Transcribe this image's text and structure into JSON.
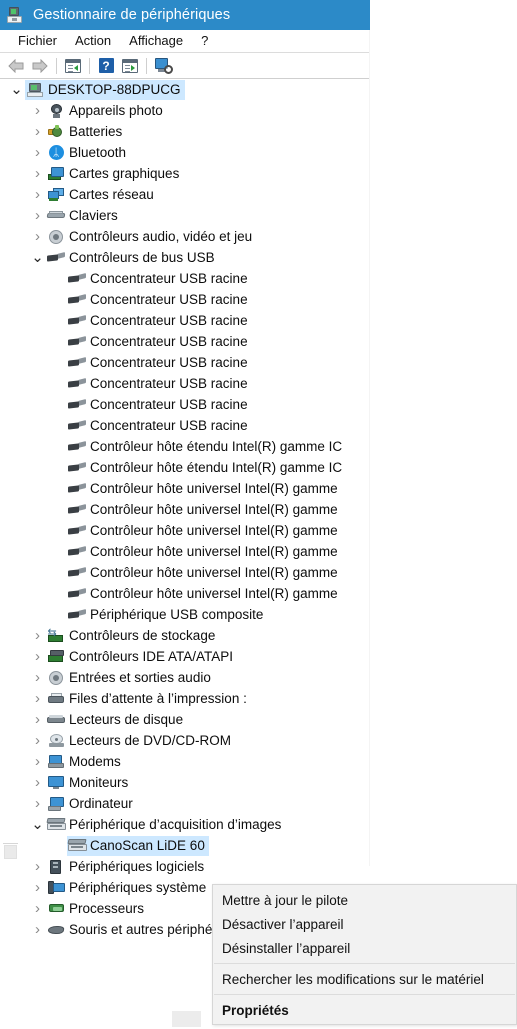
{
  "window": {
    "title": "Gestionnaire de périphériques",
    "icon": "device-manager-icon"
  },
  "menubar": {
    "items": [
      {
        "label": "Fichier",
        "name": "menu-fichier"
      },
      {
        "label": "Action",
        "name": "menu-action"
      },
      {
        "label": "Affichage",
        "name": "menu-affichage"
      },
      {
        "label": "?",
        "name": "menu-help"
      }
    ]
  },
  "toolbar": {
    "buttons": [
      {
        "icon": "back-arrow-icon",
        "label": ""
      },
      {
        "icon": "forward-arrow-icon",
        "label": ""
      },
      {
        "icon": "properties-icon",
        "label": ""
      },
      {
        "icon": "help-icon",
        "label": "?"
      },
      {
        "icon": "update-driver-icon",
        "label": ""
      },
      {
        "icon": "scan-hardware-changes-icon",
        "label": ""
      }
    ]
  },
  "tree": {
    "rows": [
      {
        "depth": 0,
        "chev": "open",
        "icon": "computer-icon",
        "label": "DESKTOP-88DPUCG",
        "selected": true
      },
      {
        "depth": 1,
        "chev": "closed",
        "icon": "camera-icon",
        "label": "Appareils photo"
      },
      {
        "depth": 1,
        "chev": "closed",
        "icon": "battery-icon",
        "label": "Batteries"
      },
      {
        "depth": 1,
        "chev": "closed",
        "icon": "bluetooth-icon",
        "label": "Bluetooth"
      },
      {
        "depth": 1,
        "chev": "closed",
        "icon": "display-adapter-icon",
        "label": "Cartes graphiques"
      },
      {
        "depth": 1,
        "chev": "closed",
        "icon": "network-adapter-icon",
        "label": "Cartes réseau"
      },
      {
        "depth": 1,
        "chev": "closed",
        "icon": "keyboard-icon",
        "label": "Claviers"
      },
      {
        "depth": 1,
        "chev": "closed",
        "icon": "audio-icon",
        "label": "Contrôleurs audio, vidéo et jeu"
      },
      {
        "depth": 1,
        "chev": "open",
        "icon": "usb-icon",
        "label": "Contrôleurs de bus USB"
      },
      {
        "depth": 2,
        "chev": "blank",
        "icon": "usb-icon",
        "label": "Concentrateur USB racine"
      },
      {
        "depth": 2,
        "chev": "blank",
        "icon": "usb-icon",
        "label": "Concentrateur USB racine"
      },
      {
        "depth": 2,
        "chev": "blank",
        "icon": "usb-icon",
        "label": "Concentrateur USB racine"
      },
      {
        "depth": 2,
        "chev": "blank",
        "icon": "usb-icon",
        "label": "Concentrateur USB racine"
      },
      {
        "depth": 2,
        "chev": "blank",
        "icon": "usb-icon",
        "label": "Concentrateur USB racine"
      },
      {
        "depth": 2,
        "chev": "blank",
        "icon": "usb-icon",
        "label": "Concentrateur USB racine"
      },
      {
        "depth": 2,
        "chev": "blank",
        "icon": "usb-icon",
        "label": "Concentrateur USB racine"
      },
      {
        "depth": 2,
        "chev": "blank",
        "icon": "usb-icon",
        "label": "Concentrateur USB racine"
      },
      {
        "depth": 2,
        "chev": "blank",
        "icon": "usb-icon",
        "label": "Contrôleur hôte étendu Intel(R) gamme IC"
      },
      {
        "depth": 2,
        "chev": "blank",
        "icon": "usb-icon",
        "label": "Contrôleur hôte étendu Intel(R) gamme IC"
      },
      {
        "depth": 2,
        "chev": "blank",
        "icon": "usb-icon",
        "label": "Contrôleur hôte universel Intel(R) gamme"
      },
      {
        "depth": 2,
        "chev": "blank",
        "icon": "usb-icon",
        "label": "Contrôleur hôte universel Intel(R) gamme"
      },
      {
        "depth": 2,
        "chev": "blank",
        "icon": "usb-icon",
        "label": "Contrôleur hôte universel Intel(R) gamme"
      },
      {
        "depth": 2,
        "chev": "blank",
        "icon": "usb-icon",
        "label": "Contrôleur hôte universel Intel(R) gamme"
      },
      {
        "depth": 2,
        "chev": "blank",
        "icon": "usb-icon",
        "label": "Contrôleur hôte universel Intel(R) gamme"
      },
      {
        "depth": 2,
        "chev": "blank",
        "icon": "usb-icon",
        "label": "Contrôleur hôte universel Intel(R) gamme"
      },
      {
        "depth": 2,
        "chev": "blank",
        "icon": "usb-icon",
        "label": "Périphérique USB composite"
      },
      {
        "depth": 1,
        "chev": "closed",
        "icon": "storage-controller-icon",
        "label": "Contrôleurs de stockage"
      },
      {
        "depth": 1,
        "chev": "closed",
        "icon": "ide-controller-icon",
        "label": "Contrôleurs IDE ATA/ATAPI"
      },
      {
        "depth": 1,
        "chev": "closed",
        "icon": "audio-icon",
        "label": "Entrées et sorties audio"
      },
      {
        "depth": 1,
        "chev": "closed",
        "icon": "printer-icon",
        "label": "Files d’attente à l’impression :"
      },
      {
        "depth": 1,
        "chev": "closed",
        "icon": "disk-drive-icon",
        "label": "Lecteurs de disque"
      },
      {
        "depth": 1,
        "chev": "closed",
        "icon": "dvd-drive-icon",
        "label": "Lecteurs de DVD/CD-ROM"
      },
      {
        "depth": 1,
        "chev": "closed",
        "icon": "modem-icon",
        "label": "Modems"
      },
      {
        "depth": 1,
        "chev": "closed",
        "icon": "monitor-icon",
        "label": "Moniteurs"
      },
      {
        "depth": 1,
        "chev": "closed",
        "icon": "computer-node-icon",
        "label": "Ordinateur"
      },
      {
        "depth": 1,
        "chev": "open",
        "icon": "scanner-icon",
        "label": "Périphérique d’acquisition d’images"
      },
      {
        "depth": 2,
        "chev": "blank",
        "icon": "scanner-icon",
        "label": "CanoScan LiDE 60",
        "selected": true
      },
      {
        "depth": 1,
        "chev": "closed",
        "icon": "software-device-icon",
        "label": "Périphériques logiciels"
      },
      {
        "depth": 1,
        "chev": "closed",
        "icon": "system-device-icon",
        "label": "Périphériques système"
      },
      {
        "depth": 1,
        "chev": "closed",
        "icon": "processor-icon",
        "label": "Processeurs"
      },
      {
        "depth": 1,
        "chev": "closed",
        "icon": "mouse-icon",
        "label": "Souris et autres périphériques de poi"
      }
    ]
  },
  "context_menu": {
    "items": [
      {
        "label": "Mettre à jour le pilote",
        "name": "ctx-update-driver",
        "bold": false,
        "sep_after": false
      },
      {
        "label": "Désactiver l’appareil",
        "name": "ctx-disable-device",
        "bold": false,
        "sep_after": false
      },
      {
        "label": "Désinstaller l’appareil",
        "name": "ctx-uninstall-device",
        "bold": false,
        "sep_after": true
      },
      {
        "label": "Rechercher les modifications sur le matériel",
        "name": "ctx-scan-hardware",
        "bold": false,
        "sep_after": true
      },
      {
        "label": "Propriétés",
        "name": "ctx-properties",
        "bold": true,
        "sep_after": false
      }
    ]
  },
  "colors": {
    "titlebar": "#2c8ac8",
    "selection": "#cde8ff",
    "menu_bg": "#f2f2f2"
  }
}
